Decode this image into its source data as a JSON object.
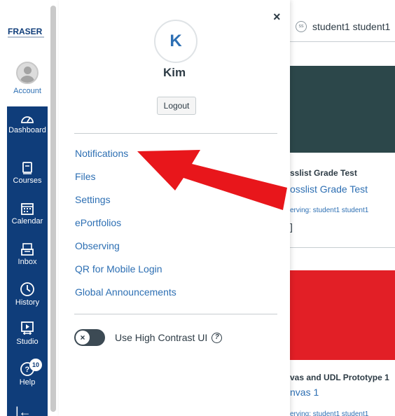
{
  "nav": {
    "logo_text": "FRASER",
    "account_label": "Account",
    "items": [
      {
        "label": "Dashboard",
        "icon": "dashboard-icon"
      },
      {
        "label": "Courses",
        "icon": "courses-icon"
      },
      {
        "label": "Calendar",
        "icon": "calendar-icon"
      },
      {
        "label": "Inbox",
        "icon": "inbox-icon"
      },
      {
        "label": "History",
        "icon": "history-icon"
      },
      {
        "label": "Studio",
        "icon": "studio-icon"
      },
      {
        "label": "Help",
        "icon": "help-icon"
      }
    ],
    "help_badge": "10",
    "collapse_glyph": "|←"
  },
  "tray": {
    "close_glyph": "×",
    "avatar_initial": "K",
    "user_name": "Kim",
    "logout_label": "Logout",
    "links": [
      "Notifications",
      "Files",
      "Settings",
      "ePortfolios",
      "Observing",
      "QR for Mobile Login",
      "Global Announcements"
    ],
    "toggle_knob": "×",
    "toggle_label": "Use High Contrast UI",
    "help_glyph": "?"
  },
  "background": {
    "observer_icon_text": "ss",
    "observer_text": "student1 student1",
    "card1_title": "sslist Grade Test",
    "card1_link": "osslist Grade Test",
    "card1_sub": "erving: student1 student1",
    "card1_extra": "]",
    "card2_title": "vas and UDL Prototype 1",
    "card2_link": "nvas 1",
    "card2_sub": "erving: student1 student1"
  },
  "colors": {
    "nav_blue": "#0f3d7a",
    "link_blue": "#2d6fb3",
    "card_dark": "#2c474a",
    "card_red": "#e21f26",
    "arrow_red": "#e8161b"
  }
}
